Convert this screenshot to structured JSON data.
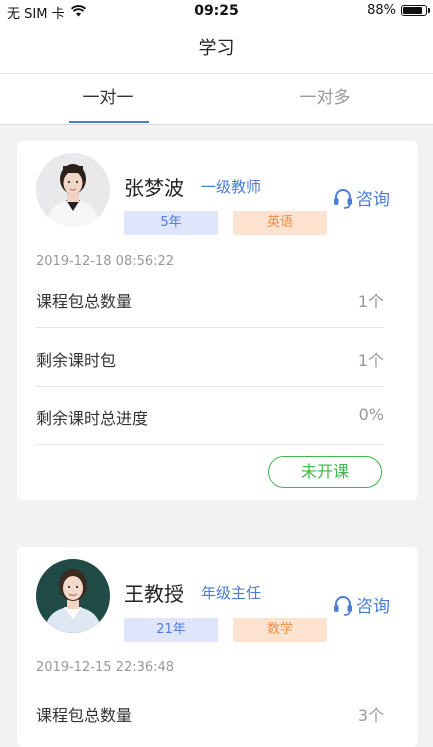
{
  "status_bar": {
    "carrier": "无 SIM 卡",
    "time": "09:25",
    "battery_text": "88%",
    "battery_level": 0.88
  },
  "header": {
    "title": "学习"
  },
  "tabs": [
    {
      "label": "一对一",
      "active": true
    },
    {
      "label": "一对多",
      "active": false
    }
  ],
  "cards": [
    {
      "name": "张梦波",
      "title": "一级教师",
      "years": "5年",
      "subject": "英语",
      "consult_label": "咨询",
      "timestamp": "2019-12-18 08:56:22",
      "rows": [
        {
          "label": "课程包总数量",
          "value": "1个"
        },
        {
          "label": "剩余课时包",
          "value": "1个"
        },
        {
          "label": "剩余课时总进度",
          "value": "0%"
        }
      ],
      "status_label": "未开课"
    },
    {
      "name": "王教授",
      "title": "年级主任",
      "years": "21年",
      "subject": "数学",
      "consult_label": "咨询",
      "timestamp": "2019-12-15 22:36:48",
      "rows": [
        {
          "label": "课程包总数量",
          "value": "3个"
        }
      ]
    }
  ],
  "colors": {
    "accent": "#4a7cd9",
    "status_green": "#40b64b",
    "subject_orange": "#ef8d44"
  }
}
